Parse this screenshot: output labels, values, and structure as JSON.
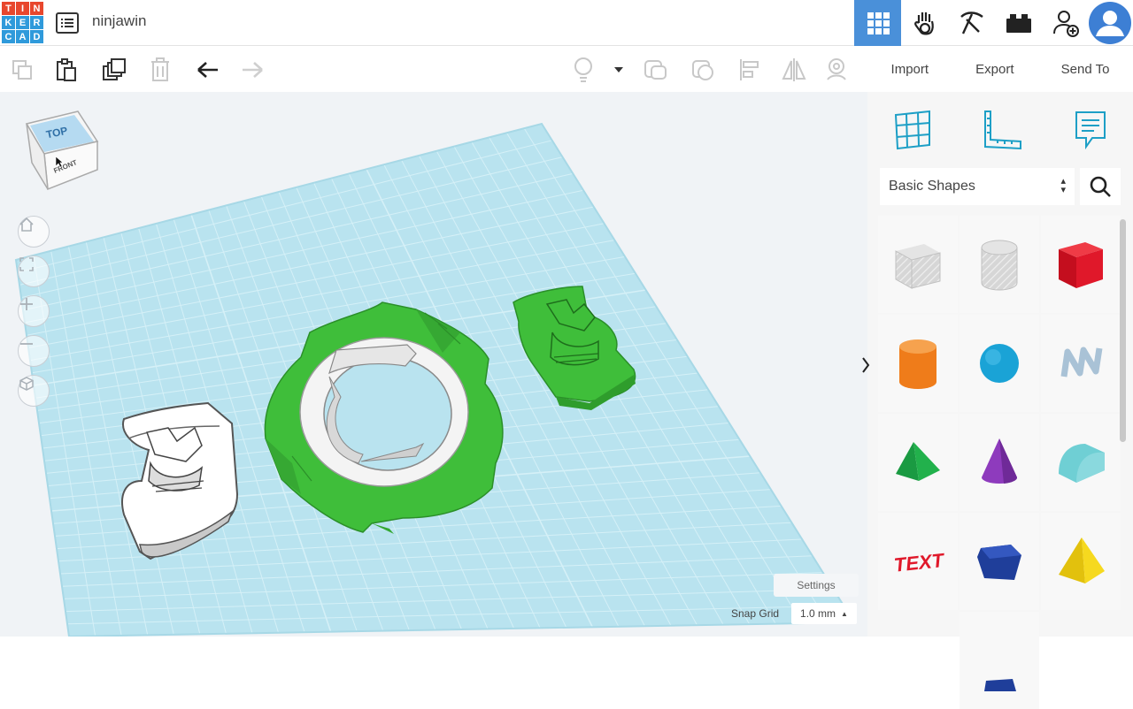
{
  "app": {
    "logo_letters": [
      "T",
      "I",
      "N",
      "K",
      "E",
      "R",
      "C",
      "A",
      "D"
    ],
    "logo_colors": [
      "#e8472d",
      "#e8472d",
      "#e8472d",
      "#2f9adb",
      "#2f9adb",
      "#2f9adb",
      "#2f9adb",
      "#2f9adb",
      "#2f9adb"
    ],
    "design_name": "ninjawin"
  },
  "topbar": {
    "icons": [
      "grid-view-icon",
      "hand-icon",
      "pickaxe-icon",
      "bricks-icon",
      "add-user-icon",
      "avatar-icon"
    ],
    "active_color": "#4a90d9"
  },
  "toolbar": {
    "tools": [
      "copy-icon",
      "paste-icon",
      "duplicate-icon",
      "delete-icon",
      "undo-icon",
      "redo-icon"
    ],
    "view_tools": [
      "light-bulb-icon",
      "dropdown-icon",
      "group-icon",
      "ungroup-icon",
      "align-icon",
      "mirror-icon",
      "hole-icon"
    ]
  },
  "right_actions": {
    "import": "Import",
    "export": "Export",
    "send_to": "Send To"
  },
  "viewcube": {
    "top_label": "TOP",
    "front_label": "FRONT"
  },
  "workplane": {
    "settings_label": "Settings",
    "snap_grid_label": "Snap Grid",
    "snap_grid_value": "1.0 mm",
    "grid_color": "#b9e3ef",
    "model_color": "#3fbe3a"
  },
  "panel": {
    "category": "Basic Shapes",
    "shapes": [
      {
        "name": "box-hole",
        "color": "#cfcfcf"
      },
      {
        "name": "cylinder-hole",
        "color": "#cfcfcf"
      },
      {
        "name": "box",
        "color": "#e0182a"
      },
      {
        "name": "cylinder",
        "color": "#ef7c1a"
      },
      {
        "name": "sphere",
        "color": "#1aa3d6"
      },
      {
        "name": "scribble",
        "color": "#a9c2d6"
      },
      {
        "name": "roof",
        "color": "#22b14c"
      },
      {
        "name": "cone",
        "color": "#8e3bbd"
      },
      {
        "name": "round-roof",
        "color": "#6fcfd4"
      },
      {
        "name": "text",
        "color": "#e0182a"
      },
      {
        "name": "polygon",
        "color": "#1f3e9a"
      },
      {
        "name": "pyramid",
        "color": "#f6d91f"
      }
    ]
  }
}
